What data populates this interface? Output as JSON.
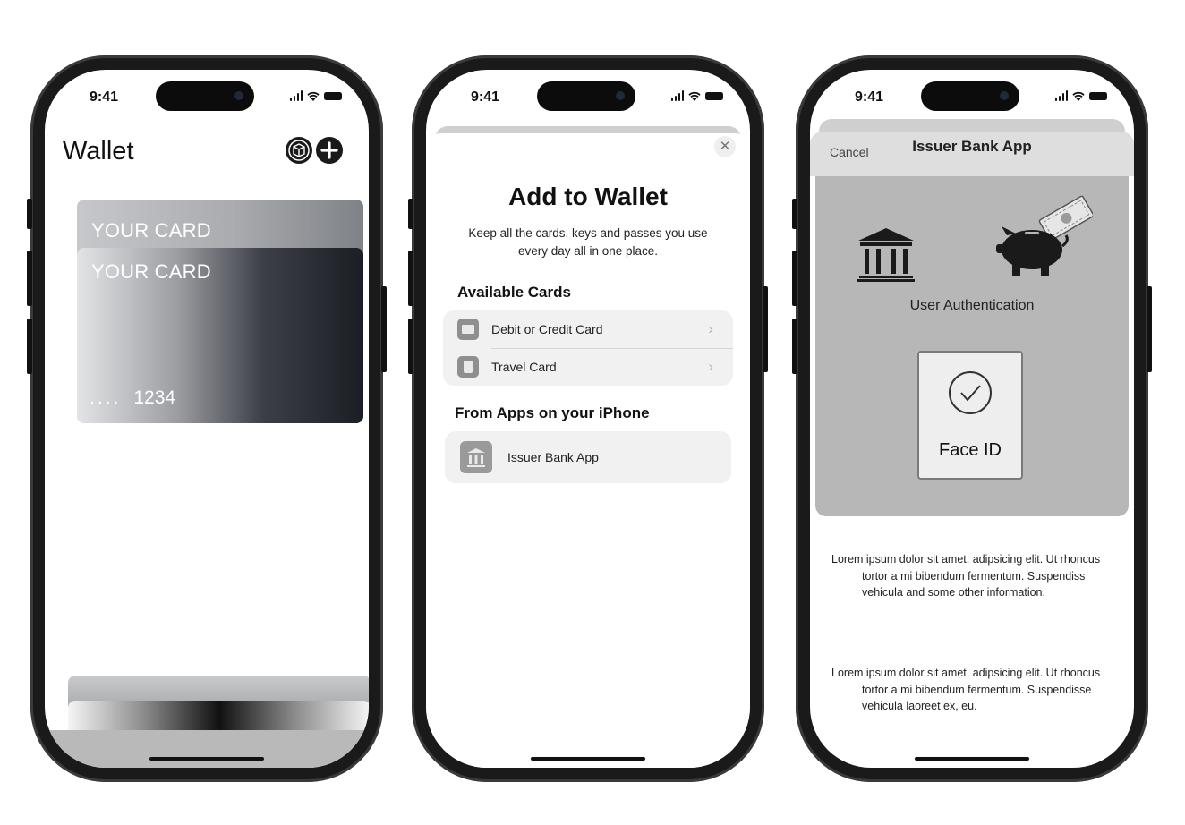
{
  "status_bar": {
    "time": "9:41"
  },
  "phone1": {
    "title": "Wallet",
    "cards": [
      {
        "label": "YOUR CARD"
      },
      {
        "label": "YOUR CARD",
        "number_dots": "....",
        "number_last4": "1234"
      }
    ]
  },
  "phone2": {
    "title": "Add to Wallet",
    "subtitle": "Keep all the cards, keys and passes you use every day all in one place.",
    "available_cards_heading": "Available Cards",
    "available_cards": [
      {
        "label": "Debit or Credit Card",
        "icon": "card-icon"
      },
      {
        "label": "Travel Card",
        "icon": "travel-card-icon"
      }
    ],
    "from_apps_heading": "From Apps on your iPhone",
    "apps": [
      {
        "label": "Issuer Bank App",
        "icon": "bank-icon"
      }
    ]
  },
  "phone3": {
    "cancel_label": "Cancel",
    "title": "Issuer Bank App",
    "auth_label": "User Authentication",
    "faceid_label": "Face ID",
    "paragraphs": [
      "Lorem ipsum dolor sit amet, adipsicing elit. Ut rhoncus tortor a mi bibendum fermentum. Suspendiss vehicula and some other information.",
      "Lorem ipsum dolor sit amet, adipsicing elit. Ut rhoncus tortor a mi bibendum fermentum. Suspendisse vehicula laoreet ex, eu."
    ]
  },
  "colors": {
    "auth_panel": "#b7b7b7",
    "grouped_bg": "#f1f1f1",
    "frame": "#1a1a1a"
  }
}
